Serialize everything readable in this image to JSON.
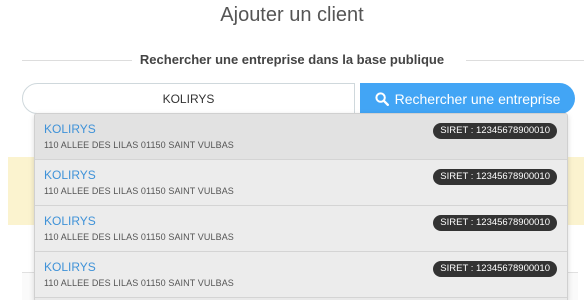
{
  "page": {
    "title": "Ajouter un client"
  },
  "search_section": {
    "heading": "Rechercher une entreprise dans la base publique",
    "input_value": "KOLIRYS",
    "button_label": "Rechercher une entreprise",
    "button_icon": "search-icon"
  },
  "results": [
    {
      "name": "KOLIRYS",
      "address": "110 ALLEE DES LILAS 01150 SAINT VULBAS",
      "siret": "SIRET : 12345678900010"
    },
    {
      "name": "KOLIRYS",
      "address": "110 ALLEE DES LILAS 01150 SAINT VULBAS",
      "siret": "SIRET : 12345678900010"
    },
    {
      "name": "KOLIRYS",
      "address": "110 ALLEE DES LILAS 01150 SAINT VULBAS",
      "siret": "SIRET : 12345678900010"
    },
    {
      "name": "KOLIRYS",
      "address": "110 ALLEE DES LILAS 01150 SAINT VULBAS",
      "siret": "SIRET : 12345678900010"
    }
  ],
  "colors": {
    "accent": "#42a5f5",
    "result_link": "#3f92d8",
    "badge": "#333333",
    "notice_background": "#fbf3cf"
  }
}
